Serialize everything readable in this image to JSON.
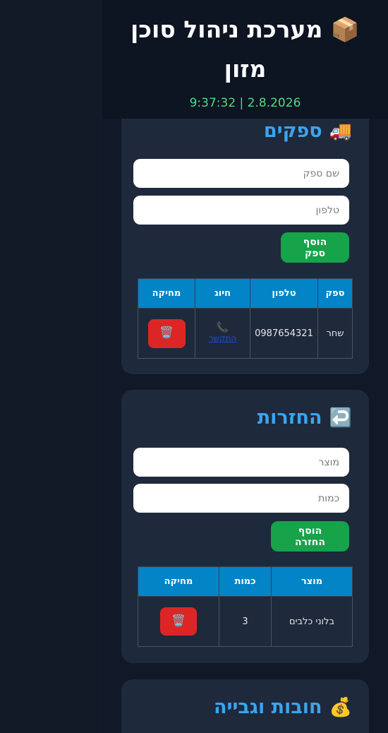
{
  "app": {
    "title": "📦 מערכת ניהול סוכן מזון",
    "clock": "9:37:32 | 2.8.2026"
  },
  "suppliers": {
    "title": "ספקים",
    "emoji": "🚚",
    "name_placeholder": "שם ספק",
    "phone_placeholder": "טלפון",
    "add_label": "הוסף ספק",
    "columns": [
      "ספק",
      "טלפון",
      "חיוג",
      "מחיקה"
    ],
    "rows": [
      {
        "name": "שחר",
        "phone": "0987654321",
        "dial_label": "התקשר"
      }
    ]
  },
  "returns": {
    "title": "החזרות",
    "emoji": "↩️",
    "product_placeholder": "מוצר",
    "qty_placeholder": "כמות",
    "add_label": "הוסף החזרה",
    "columns": [
      "מוצר",
      "כמות",
      "מחיקה"
    ],
    "rows": [
      {
        "product": "בלוני כלבים",
        "qty": "3"
      }
    ]
  },
  "debts": {
    "title": "חובות וגבייה",
    "emoji": "💰"
  },
  "icons": {
    "delete": "🗑️",
    "phone": "📞"
  }
}
